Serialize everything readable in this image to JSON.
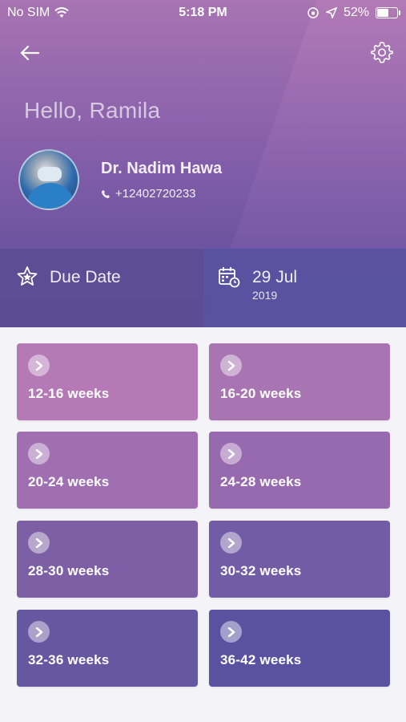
{
  "status_bar": {
    "carrier": "No SIM",
    "time": "5:18 PM",
    "battery": "52%"
  },
  "header": {
    "greeting": "Hello, Ramila",
    "doctor_name": "Dr. Nadim Hawa",
    "phone": "+12402720233"
  },
  "due": {
    "label": "Due Date",
    "date": "29 Jul",
    "year": "2019"
  },
  "weeks": [
    {
      "label": "12-16 weeks",
      "color": "#b57ab6"
    },
    {
      "label": "16-20 weeks",
      "color": "#a875b2"
    },
    {
      "label": "20-24 weeks",
      "color": "#9f6fb1"
    },
    {
      "label": "24-28 weeks",
      "color": "#9769ae"
    },
    {
      "label": "28-30 weeks",
      "color": "#7c5fa5"
    },
    {
      "label": "30-32 weeks",
      "color": "#735ca6"
    },
    {
      "label": "32-36 weeks",
      "color": "#6557a0"
    },
    {
      "label": "36-42 weeks",
      "color": "#5a52a0"
    }
  ]
}
